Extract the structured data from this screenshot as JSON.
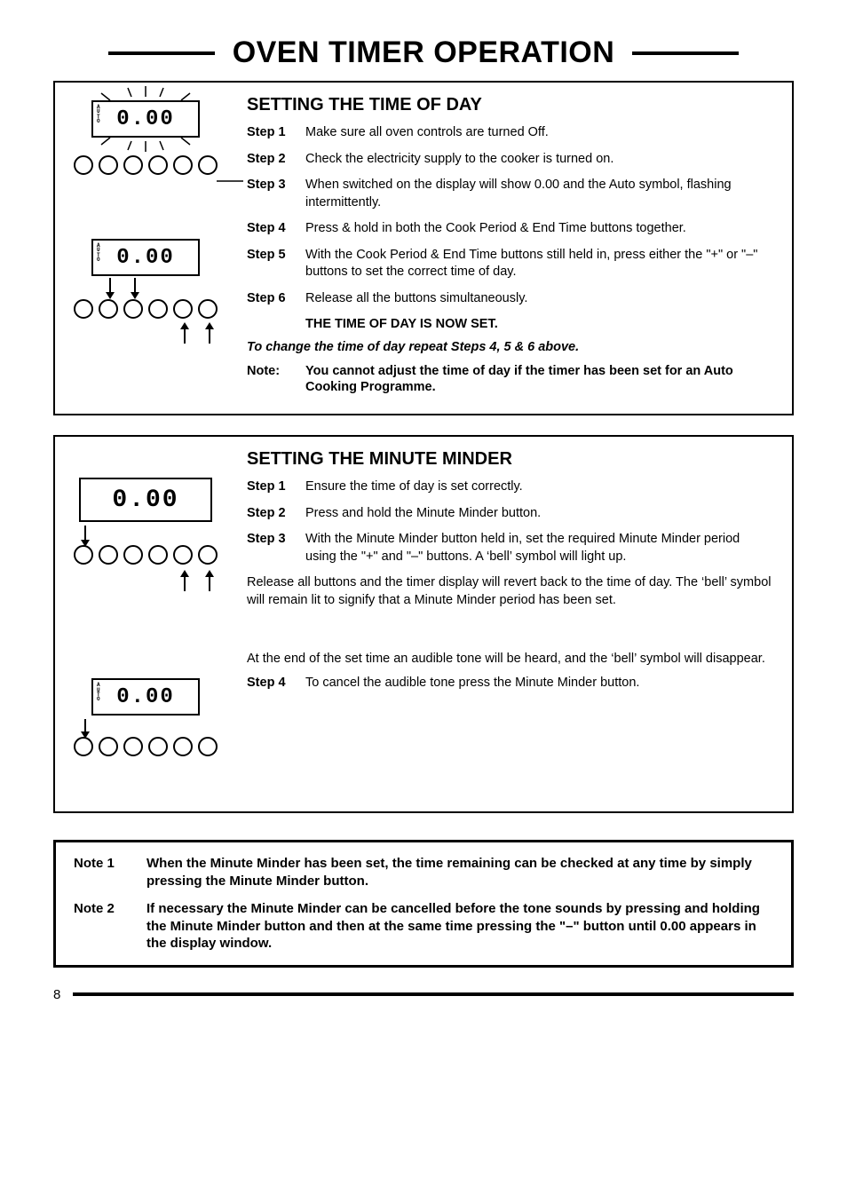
{
  "title": "OVEN TIMER OPERATION",
  "page_number": "8",
  "section1": {
    "heading": "SETTING THE TIME OF DAY",
    "display": "0.00",
    "auto": "A\nU\nT\nO",
    "steps": [
      {
        "label": "Step 1",
        "text": "Make sure all oven controls are turned Off."
      },
      {
        "label": "Step 2",
        "text": "Check the electricity supply to the cooker is turned on."
      },
      {
        "label": "Step 3",
        "text": "When switched on the display will show 0.00 and the Auto symbol, flashing intermittently."
      },
      {
        "label": "Step 4",
        "text": "Press & hold in both the Cook Period & End Time buttons together."
      },
      {
        "label": "Step 5",
        "text": "With the Cook Period & End Time buttons still held in, press either the \"+\" or \"–\" buttons to set the correct time of day."
      },
      {
        "label": "Step 6",
        "text": "Release all the buttons simultaneously."
      }
    ],
    "confirm": "THE TIME OF DAY IS NOW SET.",
    "change_text": "To change the time of day repeat Steps 4, 5 & 6 above.",
    "note_label": "Note:",
    "note_text": "You cannot adjust the time of day if the timer has been set for an Auto Cooking Programme."
  },
  "section2": {
    "heading": "SETTING THE MINUTE MINDER",
    "display": "0.00",
    "auto": "A\nU\nT\nO",
    "steps": [
      {
        "label": "Step 1",
        "text": "Ensure the time of day is set correctly."
      },
      {
        "label": "Step 2",
        "text": "Press and hold the  Minute Minder button."
      },
      {
        "label": "Step 3",
        "text": "With the Minute Minder button held in, set the required Minute Minder period using the \"+\" and \"–\" buttons. A ‘bell’ symbol will light up."
      }
    ],
    "release_text": "Release all buttons and the timer display will revert back to the time of day. The ‘bell’ symbol will remain lit to signify that a Minute Minder period has been set.",
    "end_text": "At the end of the set time an audible tone will be heard, and the ‘bell’ symbol will disappear.",
    "step4": {
      "label": "Step 4",
      "text": "To cancel the audible tone press the Minute Minder button."
    }
  },
  "notes": [
    {
      "label": "Note 1",
      "text": "When the Minute Minder has been set, the time remaining can be checked at any time by simply pressing the Minute Minder button."
    },
    {
      "label": "Note 2",
      "text": "If necessary the Minute Minder can be cancelled before the tone sounds by pressing and holding the Minute Minder button and then at the same time pressing the \"–\" button until 0.00 appears in the display window."
    }
  ]
}
